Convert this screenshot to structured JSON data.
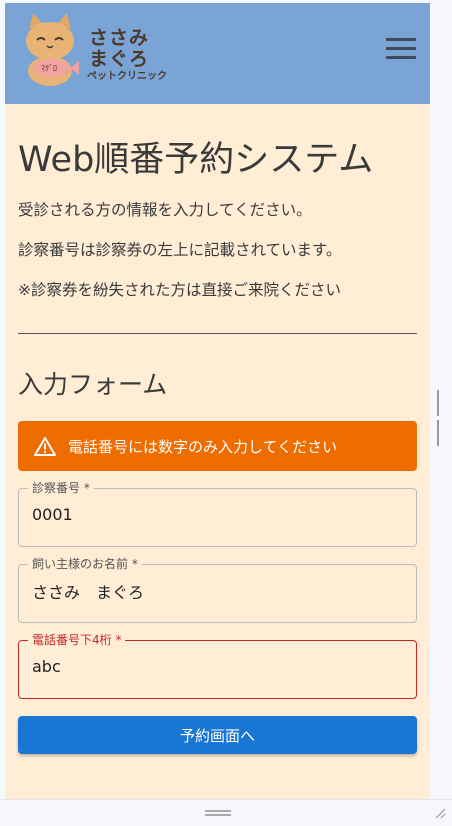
{
  "header": {
    "brand_line1": "ささみ",
    "brand_line2": "まぐろ",
    "brand_line3": "ペットクリニック",
    "fish_text": "ﾏｸﾞﾛ",
    "menu_icon": "hamburger-menu-icon"
  },
  "main": {
    "title": "Web順番予約システム",
    "info1": "受診される方の情報を入力してください。",
    "info2": "診察番号は診察券の左上に記載されています。",
    "info3": "※診察券を紛失された方は直接ご来院ください",
    "form_title": "入力フォーム"
  },
  "alert": {
    "icon": "warning-icon",
    "message": "電話番号には数字のみ入力してください",
    "color": "#ef6c00"
  },
  "form": {
    "fields": [
      {
        "label": "診察番号 *",
        "value": "0001"
      },
      {
        "label": "飼い主様のお名前 *",
        "value": "ささみ　まぐろ"
      },
      {
        "label": "電話番号下4桁 *",
        "value": "abc",
        "error": true
      }
    ],
    "submit_label": "予約画面へ"
  },
  "colors": {
    "header_bg": "#7aa3d6",
    "page_bg": "#ffedd5",
    "error": "#c62828",
    "primary": "#1976d2"
  }
}
